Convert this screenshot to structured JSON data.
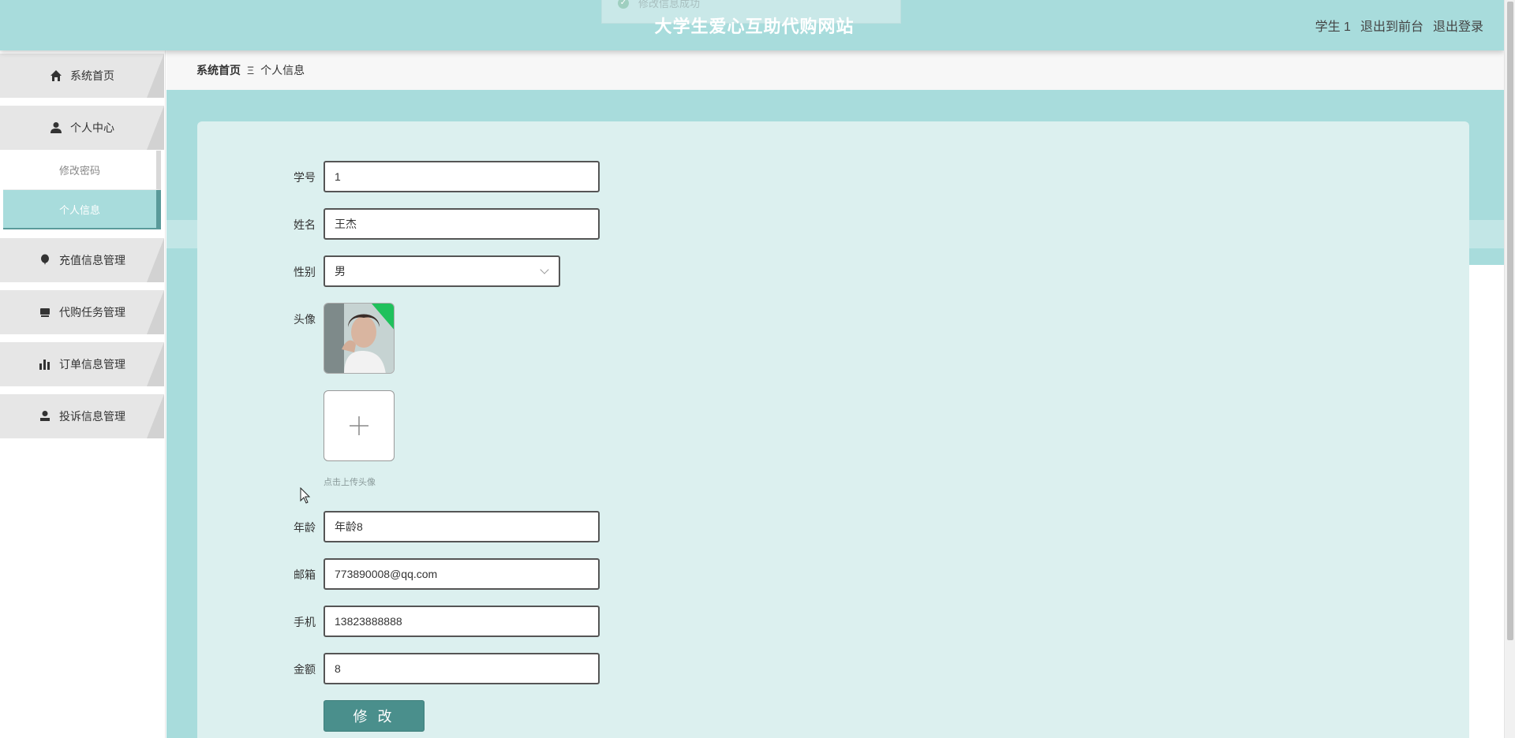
{
  "header": {
    "title": "大学生爱心互助代购网站",
    "toast": "修改信息成功",
    "user": "学生 1",
    "to_front": "退出到前台",
    "logout": "退出登录"
  },
  "sidebar": {
    "items": [
      {
        "label": "系统首页",
        "icon": "home-icon"
      },
      {
        "label": "个人中心",
        "icon": "user-icon"
      },
      {
        "label": "充值信息管理",
        "icon": "balloon-icon"
      },
      {
        "label": "代购任务管理",
        "icon": "cart-icon"
      },
      {
        "label": "订单信息管理",
        "icon": "bar-chart-icon"
      },
      {
        "label": "投诉信息管理",
        "icon": "person-icon"
      }
    ],
    "subitems": [
      {
        "label": "修改密码"
      },
      {
        "label": "个人信息"
      }
    ]
  },
  "breadcrumb": {
    "home": "系统首页",
    "separator": "Ξ",
    "current": "个人信息"
  },
  "form": {
    "student_id": {
      "label": "学号",
      "value": "1"
    },
    "name": {
      "label": "姓名",
      "value": "王杰"
    },
    "gender": {
      "label": "性别",
      "value": "男"
    },
    "avatar": {
      "label": "头像",
      "upload_hint": "点击上传头像"
    },
    "age": {
      "label": "年龄",
      "value": "年龄8"
    },
    "email": {
      "label": "邮箱",
      "value": "773890008@qq.com"
    },
    "phone": {
      "label": "手机",
      "value": "13823888888"
    },
    "balance": {
      "label": "金额",
      "value": "8"
    },
    "submit_label": "修 改"
  },
  "colors": {
    "accent": "#a8dcdc",
    "button": "#4a8f8c",
    "panel": "#dcf0ef"
  }
}
